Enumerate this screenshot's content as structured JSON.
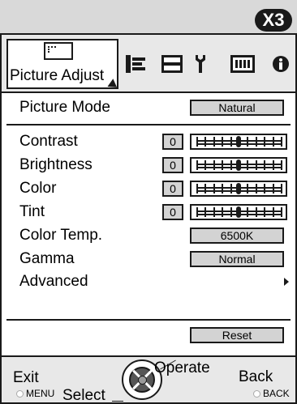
{
  "badge": "X3",
  "tabs": {
    "active": {
      "label": "Picture Adjust",
      "icon": "picture-icon"
    },
    "others": [
      {
        "icon": "signal-bars-icon"
      },
      {
        "icon": "screen-icon"
      },
      {
        "icon": "wrench-icon"
      },
      {
        "icon": "battery-icon"
      },
      {
        "icon": "info-icon"
      }
    ]
  },
  "rows": {
    "picture_mode": {
      "label": "Picture Mode",
      "value": "Natural"
    },
    "contrast": {
      "label": "Contrast",
      "value": "0",
      "level": 0.5
    },
    "brightness": {
      "label": "Brightness",
      "value": "0",
      "level": 0.5
    },
    "color": {
      "label": "Color",
      "value": "0",
      "level": 0.5
    },
    "tint": {
      "label": "Tint",
      "value": "0",
      "level": 0.5
    },
    "color_temp": {
      "label": "Color Temp.",
      "value": "6500K"
    },
    "gamma": {
      "label": "Gamma",
      "value": "Normal"
    },
    "advanced": {
      "label": "Advanced"
    },
    "reset": {
      "label": "Reset"
    }
  },
  "footer": {
    "exit": "Exit",
    "menu": "MENU",
    "select": "Select",
    "operate": "Operate",
    "back": "Back",
    "back_sub": "BACK"
  }
}
